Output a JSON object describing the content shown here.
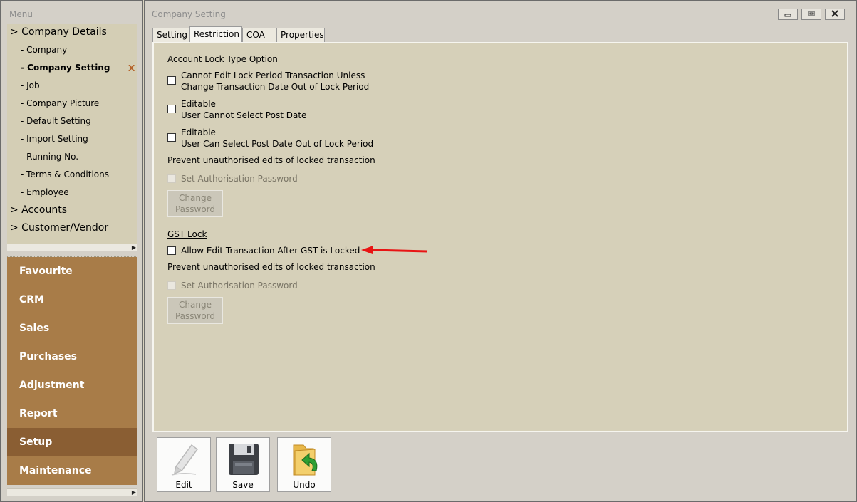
{
  "menu": {
    "title": "Menu",
    "tree": [
      {
        "label": "> Company Details",
        "level": 0
      },
      {
        "label": "- Company",
        "level": 1
      },
      {
        "label": "- Company Setting",
        "level": 1,
        "selected": true
      },
      {
        "label": "- Job",
        "level": 1
      },
      {
        "label": "- Company Picture",
        "level": 1
      },
      {
        "label": "- Default Setting",
        "level": 1
      },
      {
        "label": "- Import Setting",
        "level": 1
      },
      {
        "label": "- Running No.",
        "level": 1
      },
      {
        "label": "- Terms & Conditions",
        "level": 1
      },
      {
        "label": "- Employee",
        "level": 1
      },
      {
        "label": "> Accounts",
        "level": 0
      },
      {
        "label": "> Customer/Vendor",
        "level": 0
      }
    ],
    "close_mark": "X",
    "groups": [
      "Favourite",
      "CRM",
      "Sales",
      "Purchases",
      "Adjustment",
      "Report",
      "Setup",
      "Maintenance"
    ],
    "active_group": "Setup"
  },
  "window": {
    "title": "Company Setting",
    "tabs": [
      "Setting",
      "Restriction",
      "COA",
      "Properties"
    ],
    "active_tab": "Restriction"
  },
  "restriction": {
    "account_lock_title": "Account Lock Type Option",
    "opt1_line1": "Cannot Edit Lock Period Transaction Unless",
    "opt1_line2": "Change Transaction Date Out of Lock Period",
    "opt2_line1": "Editable",
    "opt2_line2": "User Cannot Select Post Date",
    "opt3_line1": "Editable",
    "opt3_line2": "User Can Select Post Date Out of Lock Period",
    "prevent1": "Prevent unauthorised edits of locked transaction",
    "set_auth1": "Set Authorisation Password",
    "change_pw1_line1": "Change",
    "change_pw1_line2": "Password",
    "gst_lock_title": "GST Lock",
    "gst_opt": "Allow Edit Transaction After GST is Locked",
    "prevent2": "Prevent unauthorised edits of locked transaction",
    "set_auth2": "Set Authorisation Password",
    "change_pw2_line1": "Change",
    "change_pw2_line2": "Password"
  },
  "toolbar": {
    "edit": "Edit",
    "save": "Save",
    "undo": "Undo"
  },
  "colors": {
    "menu_group_bg": "#a87c48",
    "menu_group_active": "#8a5e33",
    "annotation_arrow": "#e81414"
  }
}
